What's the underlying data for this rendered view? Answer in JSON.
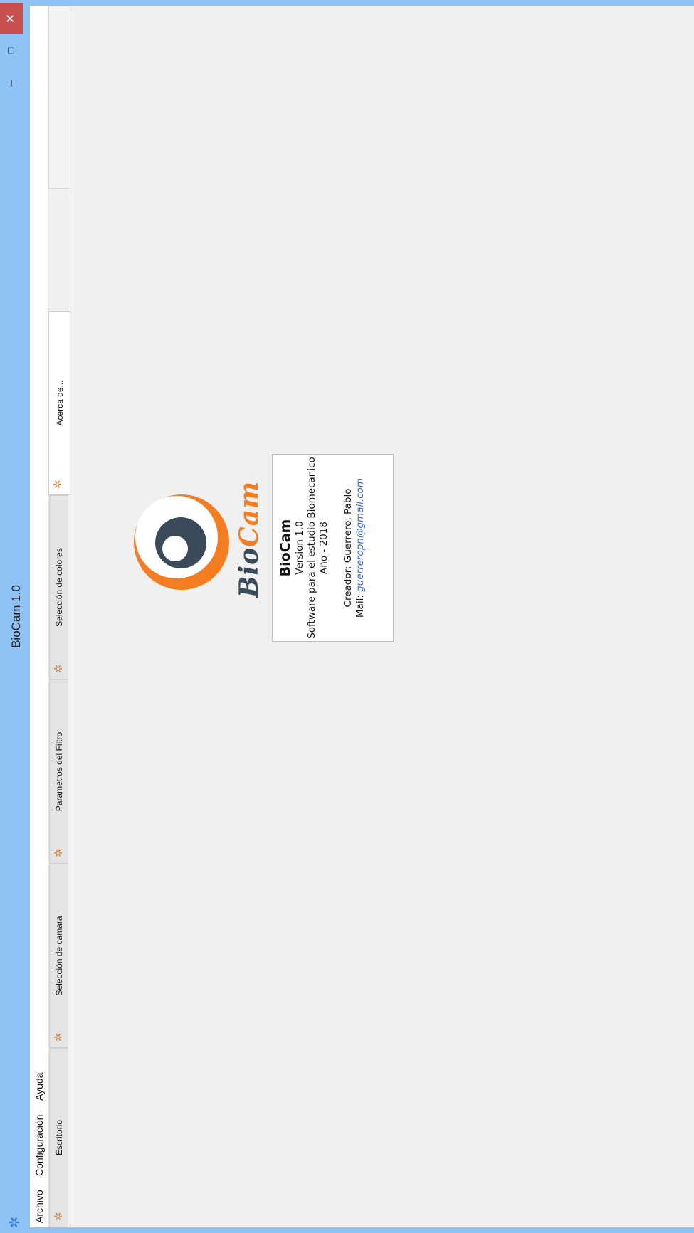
{
  "window": {
    "title": "BioCam 1.0",
    "app_icon": "app-snowflake-icon",
    "controls": {
      "minimize": "–",
      "maximize": "☐",
      "close": "✕"
    }
  },
  "menubar": {
    "items": [
      {
        "label": "Archivo"
      },
      {
        "label": "Configuración"
      },
      {
        "label": "Ayuda"
      }
    ]
  },
  "tabs": {
    "items": [
      {
        "label": "Escritorio",
        "icon": "snowflake-icon",
        "active": false
      },
      {
        "label": "Selección de camara",
        "icon": "snowflake-icon",
        "active": false
      },
      {
        "label": "Parametros del Filtro",
        "icon": "snowflake-icon",
        "active": false
      },
      {
        "label": "Selección de colores",
        "icon": "snowflake-icon",
        "active": false
      },
      {
        "label": "Acerca de...",
        "icon": "snowflake-icon",
        "active": true
      }
    ]
  },
  "about": {
    "logo_word_bio": "Bio",
    "logo_word_cam": "Cam",
    "name": "BioCam",
    "version": "Version 1.0",
    "description": "Software para el estudio Biomecanico",
    "year": "Año - 2018",
    "creator": "Creador: Guerrero, Pablo",
    "mail_label": "Mail:",
    "mail_address": "guerreropn@gmail.com"
  },
  "colors": {
    "titlebar": "#8fc3f5",
    "close_button": "#c7504f",
    "logo_orange": "#f47d22",
    "logo_dark": "#3a4a5a",
    "link": "#2e66d6"
  }
}
